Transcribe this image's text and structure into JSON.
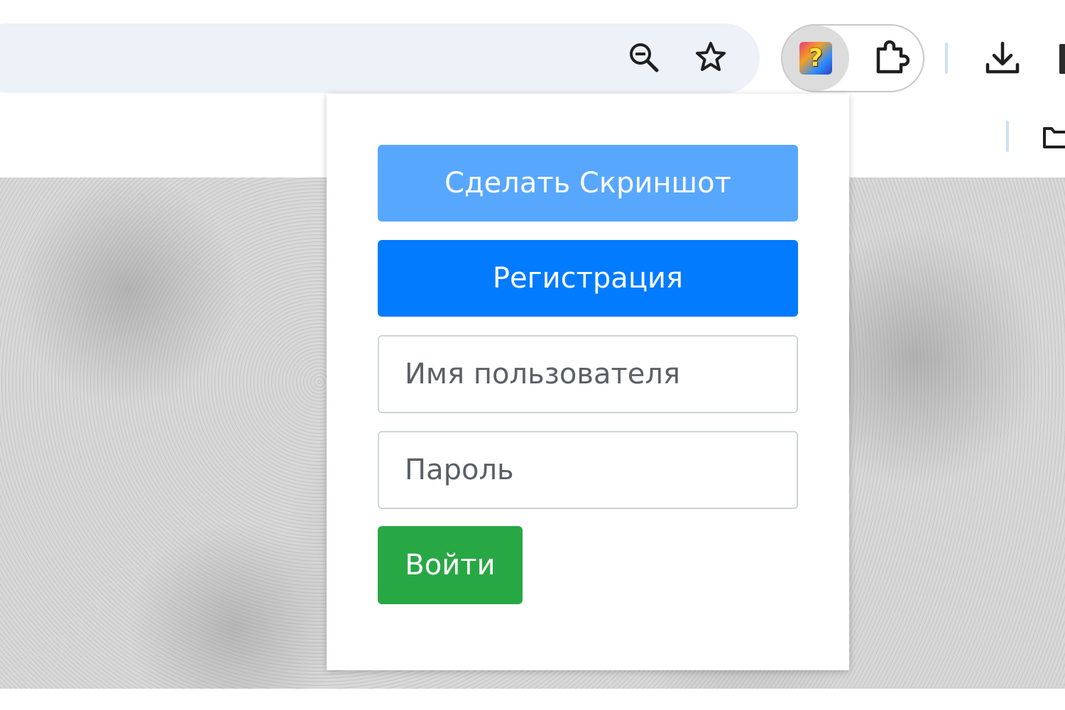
{
  "colors": {
    "omnibox_bg": "#edf1f8",
    "screenshot_button": "#58a7ff",
    "register_button": "#037bfe",
    "login_button": "#28a745",
    "field_border": "#cfd4d9"
  },
  "toolbar": {
    "icons": [
      "zoom-out-icon",
      "bookmark-star-icon",
      "extension-app-icon",
      "extensions-puzzle-icon",
      "download-icon",
      "folder-icon"
    ],
    "extension_logo_glyph": "?"
  },
  "popup": {
    "screenshot_label": "Сделать Скриншот",
    "register_label": "Регистрация",
    "username_placeholder": "Имя пользователя",
    "password_placeholder": "Пароль",
    "login_label": "Войти"
  }
}
